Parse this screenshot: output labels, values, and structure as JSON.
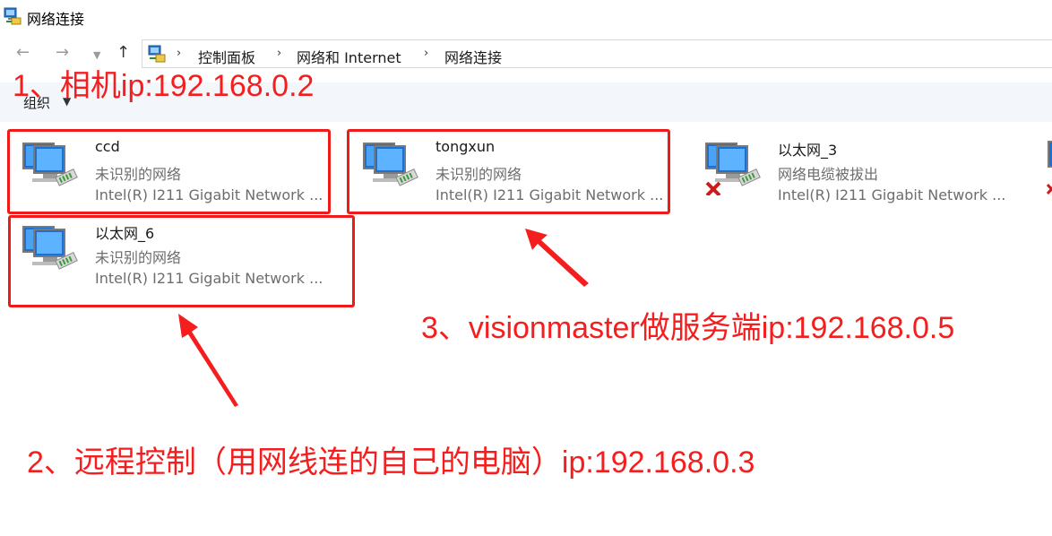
{
  "window": {
    "title": "网络连接",
    "icon": "network-connections-icon"
  },
  "nav": {
    "back_icon": "back-arrow-icon",
    "forward_icon": "forward-arrow-icon",
    "recent_icon": "chevron-down-icon",
    "up_icon": "up-arrow-icon"
  },
  "breadcrumb": {
    "icon": "control-panel-icon",
    "items": [
      "控制面板",
      "网络和 Internet",
      "网络连接"
    ]
  },
  "toolbar": {
    "organize_label": "组织"
  },
  "adapters": [
    {
      "name": "ccd",
      "status": "未识别的网络",
      "adapter": "Intel(R) I211 Gigabit Network ...",
      "disconnected": false
    },
    {
      "name": "tongxun",
      "status": "未识别的网络",
      "adapter": "Intel(R) I211 Gigabit Network ...",
      "disconnected": false
    },
    {
      "name": "以太网_3",
      "status": "网络电缆被拔出",
      "adapter": "Intel(R) I211 Gigabit Network ...",
      "disconnected": true
    },
    {
      "name": "以太网_6",
      "status": "未识别的网络",
      "adapter": "Intel(R) I211 Gigabit Network ...",
      "disconnected": false
    }
  ],
  "annotations": {
    "camera": "1、相机ip:192.168.0.2",
    "server": "3、visionmaster做服务端ip:192.168.0.5",
    "remote": "2、远程控制（用网线连的自己的电脑）ip:192.168.0.3"
  },
  "colors": {
    "annotation_red": "#f51e1e",
    "cmdbar_bg": "#f3f6fb",
    "status_gray": "#6d6d6d"
  }
}
